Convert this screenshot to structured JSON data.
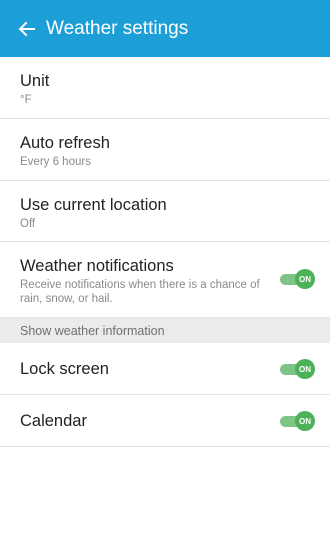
{
  "app_bar": {
    "title": "Weather settings",
    "back_icon": "arrow-left-icon",
    "color": "#1b9fd6"
  },
  "settings": {
    "unit": {
      "label": "Unit",
      "value": "°F"
    },
    "auto_refresh": {
      "label": "Auto refresh",
      "value": "Every 6 hours"
    },
    "current_location": {
      "label": "Use current location",
      "value": "Off"
    },
    "notifications": {
      "label": "Weather notifications",
      "description": "Receive notifications when there is a chance of rain, snow, or hail.",
      "toggle": "ON"
    }
  },
  "show_info": {
    "header": "Show weather information",
    "lock_screen": {
      "label": "Lock screen",
      "toggle": "ON"
    },
    "calendar": {
      "label": "Calendar",
      "toggle": "ON"
    }
  },
  "colors": {
    "toggle_on": "#4cb158",
    "toggle_track": "#7dc486"
  }
}
